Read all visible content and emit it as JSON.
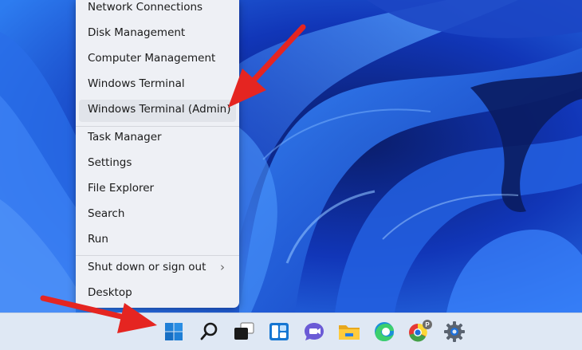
{
  "menu": {
    "items": [
      {
        "label": "Network Connections"
      },
      {
        "label": "Disk Management"
      },
      {
        "label": "Computer Management"
      },
      {
        "label": "Windows Terminal"
      },
      {
        "label": "Windows Terminal (Admin)",
        "highlighted": true
      },
      {
        "label": "Task Manager"
      },
      {
        "label": "Settings"
      },
      {
        "label": "File Explorer"
      },
      {
        "label": "Search"
      },
      {
        "label": "Run"
      },
      {
        "label": "Shut down or sign out",
        "submenu_icon": "chevron-right-icon",
        "glyph": "›"
      },
      {
        "label": "Desktop"
      }
    ]
  },
  "taskbar": {
    "icons": [
      "windows-start-icon",
      "search-icon",
      "task-view-icon",
      "widgets-icon",
      "teams-chat-icon",
      "file-explorer-icon",
      "edge-icon",
      "chrome-icon",
      "settings-gear-icon"
    ],
    "chrome_profile_badge": "P"
  },
  "colors": {
    "annotation_arrow": "#e52521",
    "wallpaper_blue": "#1a4fd8",
    "taskbar_bg": "#dfe8f4",
    "menu_bg": "#eef0f5"
  }
}
